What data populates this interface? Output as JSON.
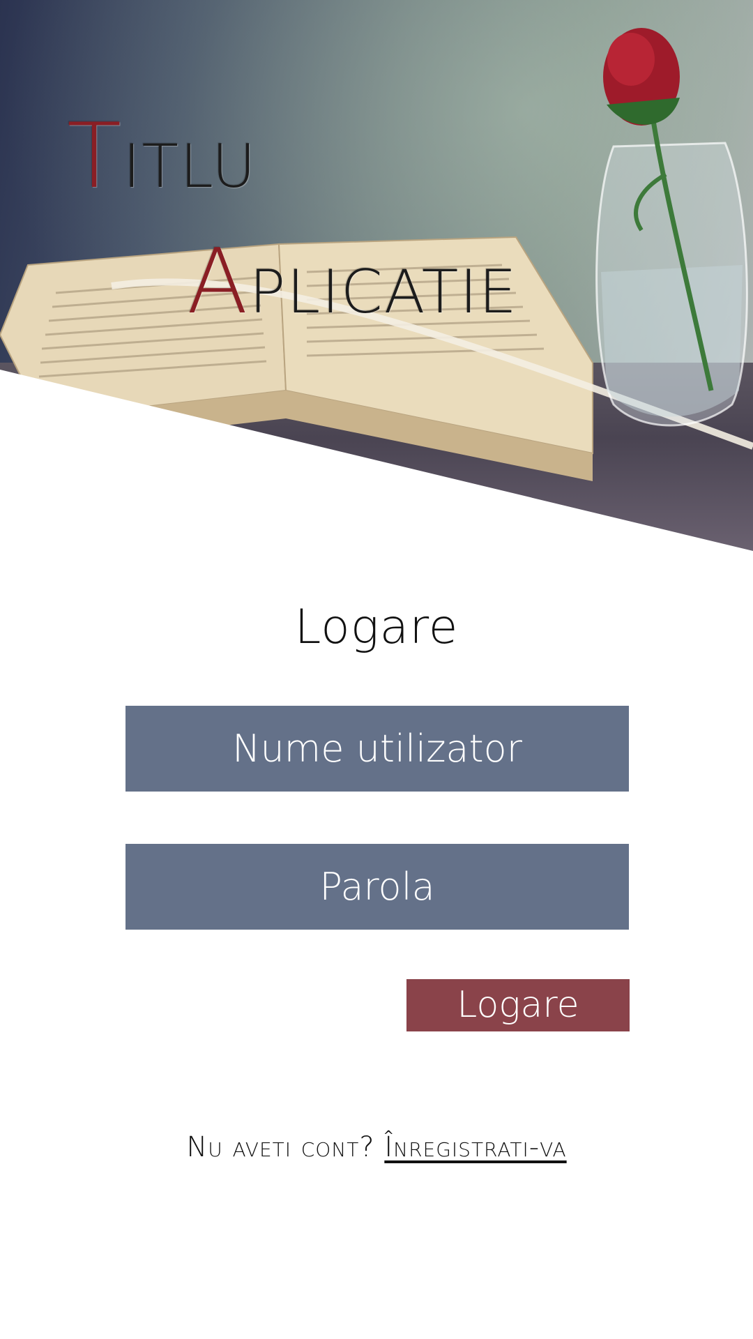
{
  "hero": {
    "title_line_1_initial": "T",
    "title_line_1_rest": "ITLU",
    "title_line_2_initial": "A",
    "title_line_2_rest": "PLICATIE"
  },
  "login": {
    "heading": "Logare",
    "username_placeholder": "Nume utilizator",
    "password_placeholder": "Parola",
    "submit_label": "Logare"
  },
  "signup": {
    "prompt": "Nu aveti cont?",
    "link_label": "Înregistrati-va"
  },
  "colors": {
    "field_background": "#647189",
    "button_background": "#8a434a",
    "title_accent": "#8a1e24"
  }
}
